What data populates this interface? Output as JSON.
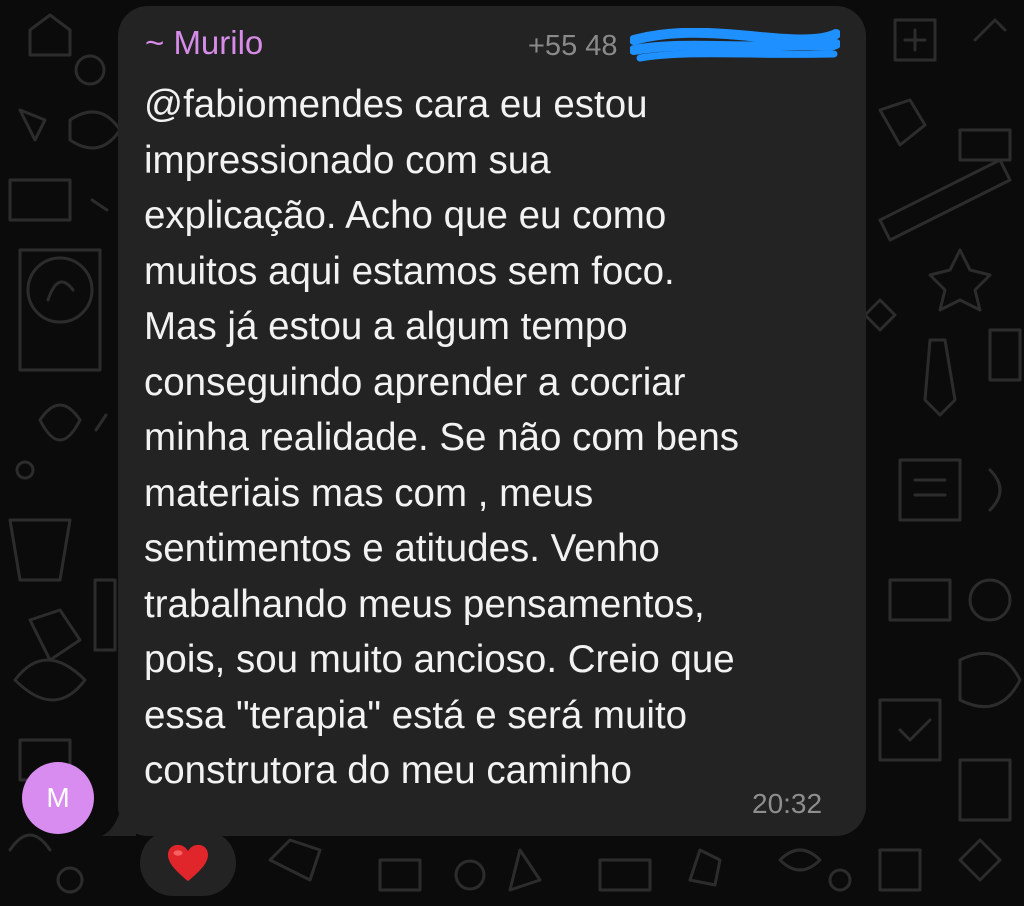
{
  "message": {
    "sender_name": "~ Murilo",
    "sender_phone": "+55 48",
    "text": "@fabiomendes cara eu estou\nimpressionado com sua\nexplicação. Acho que eu como\nmuitos aqui estamos sem foco.\nMas já estou a algum tempo\nconseguindo aprender a cocriar\nminha realidade. Se não com bens\nmateriais mas com , meus\nsentimentos  e atitudes. Venho\ntrabalhando meus pensamentos,\npois, sou muito ancioso. Creio que\nessa \"terapia\" está e será muito\nconstrutora do meu caminho",
    "time": "20:32"
  },
  "avatar": {
    "initial": "M",
    "color": "#d98cf0"
  },
  "reaction": {
    "icon": "heart-icon",
    "color": "#e0262b"
  },
  "colors": {
    "bubble": "#232323",
    "sender_name": "#d78ce9",
    "redaction": "#1e90ff"
  }
}
